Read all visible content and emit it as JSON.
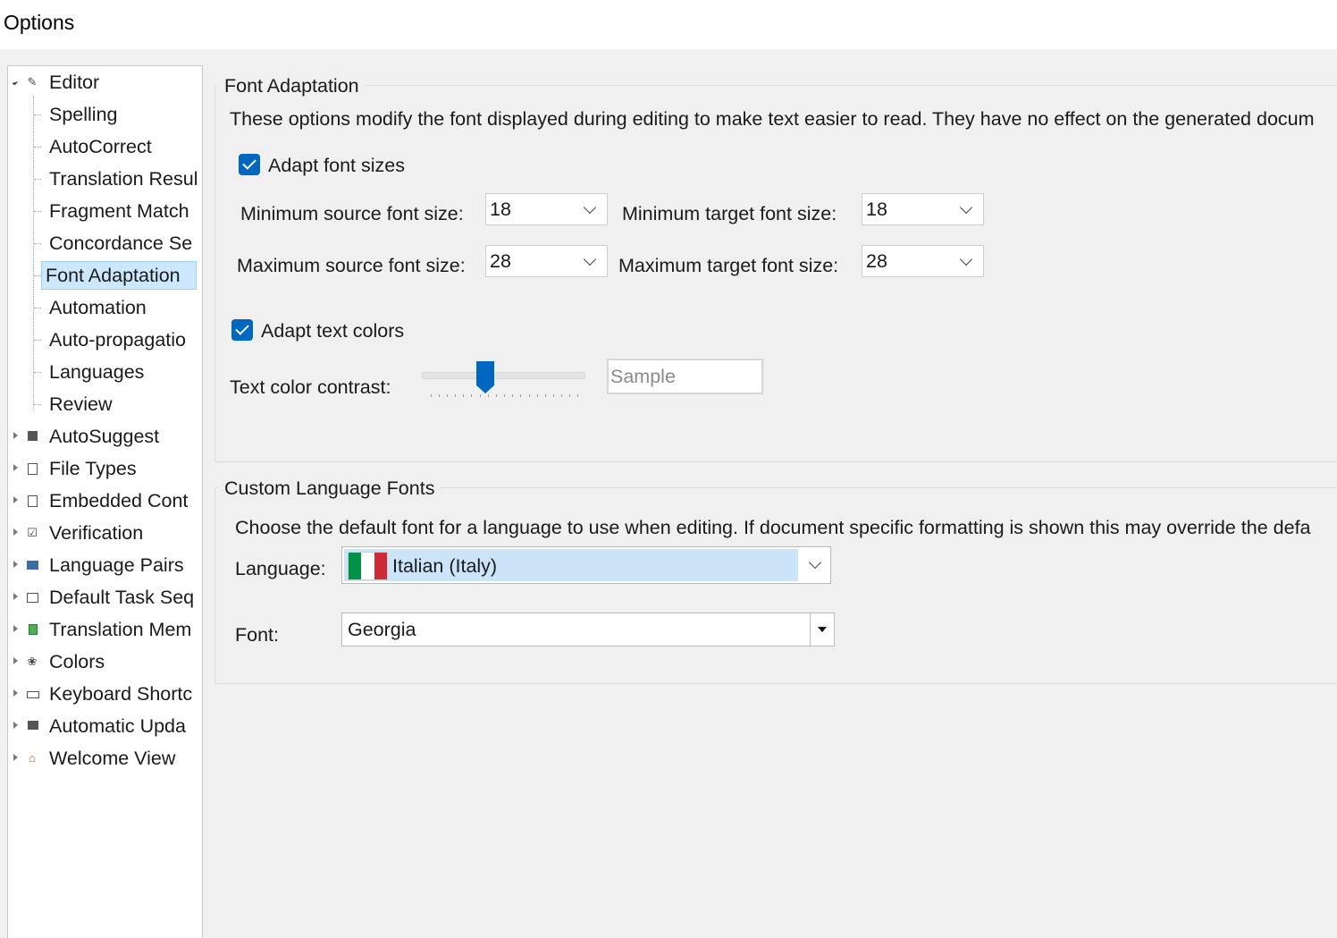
{
  "window": {
    "title": "Options"
  },
  "tree": {
    "editor": "Editor",
    "children": [
      "Spelling",
      "AutoCorrect",
      "Translation Resul",
      "Fragment Match",
      "Concordance Se",
      "Font Adaptation",
      "Automation",
      "Auto-propagatio",
      "Languages",
      "Review"
    ],
    "selected": "Font Adaptation",
    "top_level": [
      {
        "label": "AutoSuggest",
        "icon": "autosuggest-icon"
      },
      {
        "label": "File Types",
        "icon": "file-types-icon"
      },
      {
        "label": "Embedded Cont",
        "icon": "embedded-content-icon"
      },
      {
        "label": "Verification",
        "icon": "verification-icon"
      },
      {
        "label": "Language Pairs",
        "icon": "language-pairs-icon"
      },
      {
        "label": "Default Task Seq",
        "icon": "task-sequence-icon"
      },
      {
        "label": "Translation Mem",
        "icon": "translation-memory-icon"
      },
      {
        "label": "Colors",
        "icon": "colors-icon"
      },
      {
        "label": "Keyboard Shortc",
        "icon": "keyboard-icon"
      },
      {
        "label": "Automatic Upda",
        "icon": "update-icon"
      },
      {
        "label": "Welcome View",
        "icon": "home-icon"
      }
    ]
  },
  "font_adaptation": {
    "title": "Font Adaptation",
    "description": "These options modify the font displayed during editing to make text easier to read. They have no effect on the generated docum",
    "adapt_font_sizes": {
      "label": "Adapt font sizes",
      "checked": true
    },
    "min_source": {
      "label": "Minimum source font size:",
      "value": "18"
    },
    "min_target": {
      "label": "Minimum target font size:",
      "value": "18"
    },
    "max_source": {
      "label": "Maximum source font size:",
      "value": "28"
    },
    "max_target": {
      "label": "Maximum target font size:",
      "value": "28"
    },
    "adapt_text_colors": {
      "label": "Adapt text colors",
      "checked": true
    },
    "contrast": {
      "label": "Text color contrast:",
      "value_fraction": 0.35,
      "sample_text": "Sample"
    }
  },
  "custom_language_fonts": {
    "title": "Custom Language Fonts",
    "description": "Choose the default font for a language to use when editing. If document specific formatting is shown this may override the defa",
    "language_label": "Language:",
    "language_value": "Italian (Italy)",
    "font_label": "Font:",
    "font_value": "Georgia"
  },
  "colors": {
    "accent": "#0067c0",
    "selection": "#cce8ff",
    "flag": [
      "#009246",
      "#ffffff",
      "#ce2b37"
    ]
  }
}
